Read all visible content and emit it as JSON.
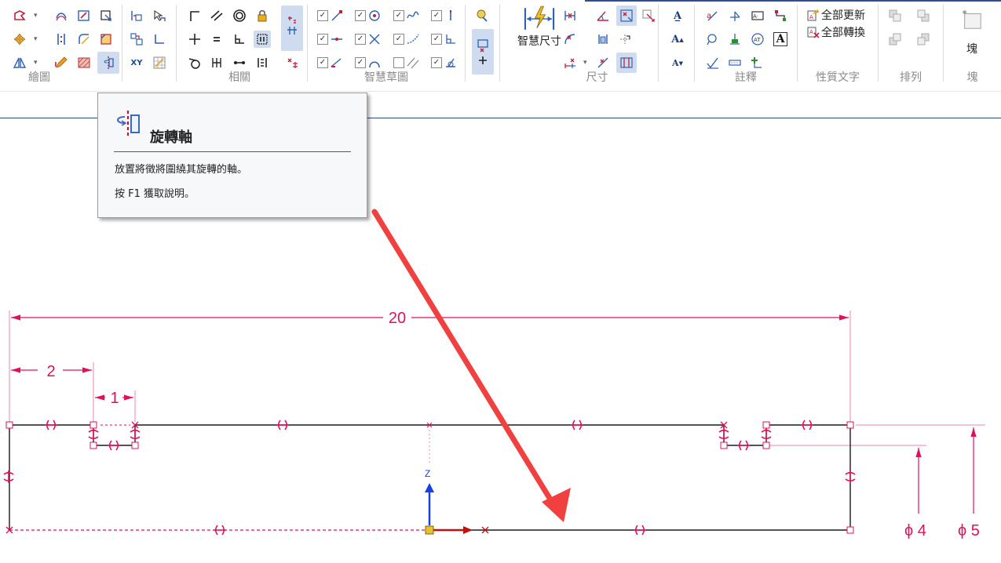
{
  "ribbon": {
    "groups": {
      "draw": "繪圖",
      "relations": "相關",
      "smart_sketch": "智慧草圖",
      "dimension": "尺寸",
      "annotation": "註釋",
      "property_text": "性質文字",
      "arrange": "排列",
      "block": "塊"
    },
    "smart_dimension_label": "智慧尺寸",
    "update_all_label": "全部更新",
    "convert_all_label": "全部轉換",
    "block_button_label": "塊",
    "xy_label": "XY",
    "accent_color": "#2f4f8f",
    "selected_color": "#cfdcf0"
  },
  "tooltip": {
    "title": "旋轉軸",
    "description": "放置將徵將圍繞其旋轉的軸。",
    "help": "按 F1 獲取說明。",
    "icon": "revolve-axis-icon"
  },
  "sketch": {
    "dim_overall": "20",
    "dim_left_offset": "2",
    "dim_groove_width": "1",
    "dim_diameter_inner": "ϕ 4",
    "dim_diameter_outer": "ϕ 5",
    "axis_label": "Z",
    "dimension_color": "#e0105a",
    "geometry_color": "#1a1a1a",
    "annotation_arrow_color": "#f04040"
  }
}
